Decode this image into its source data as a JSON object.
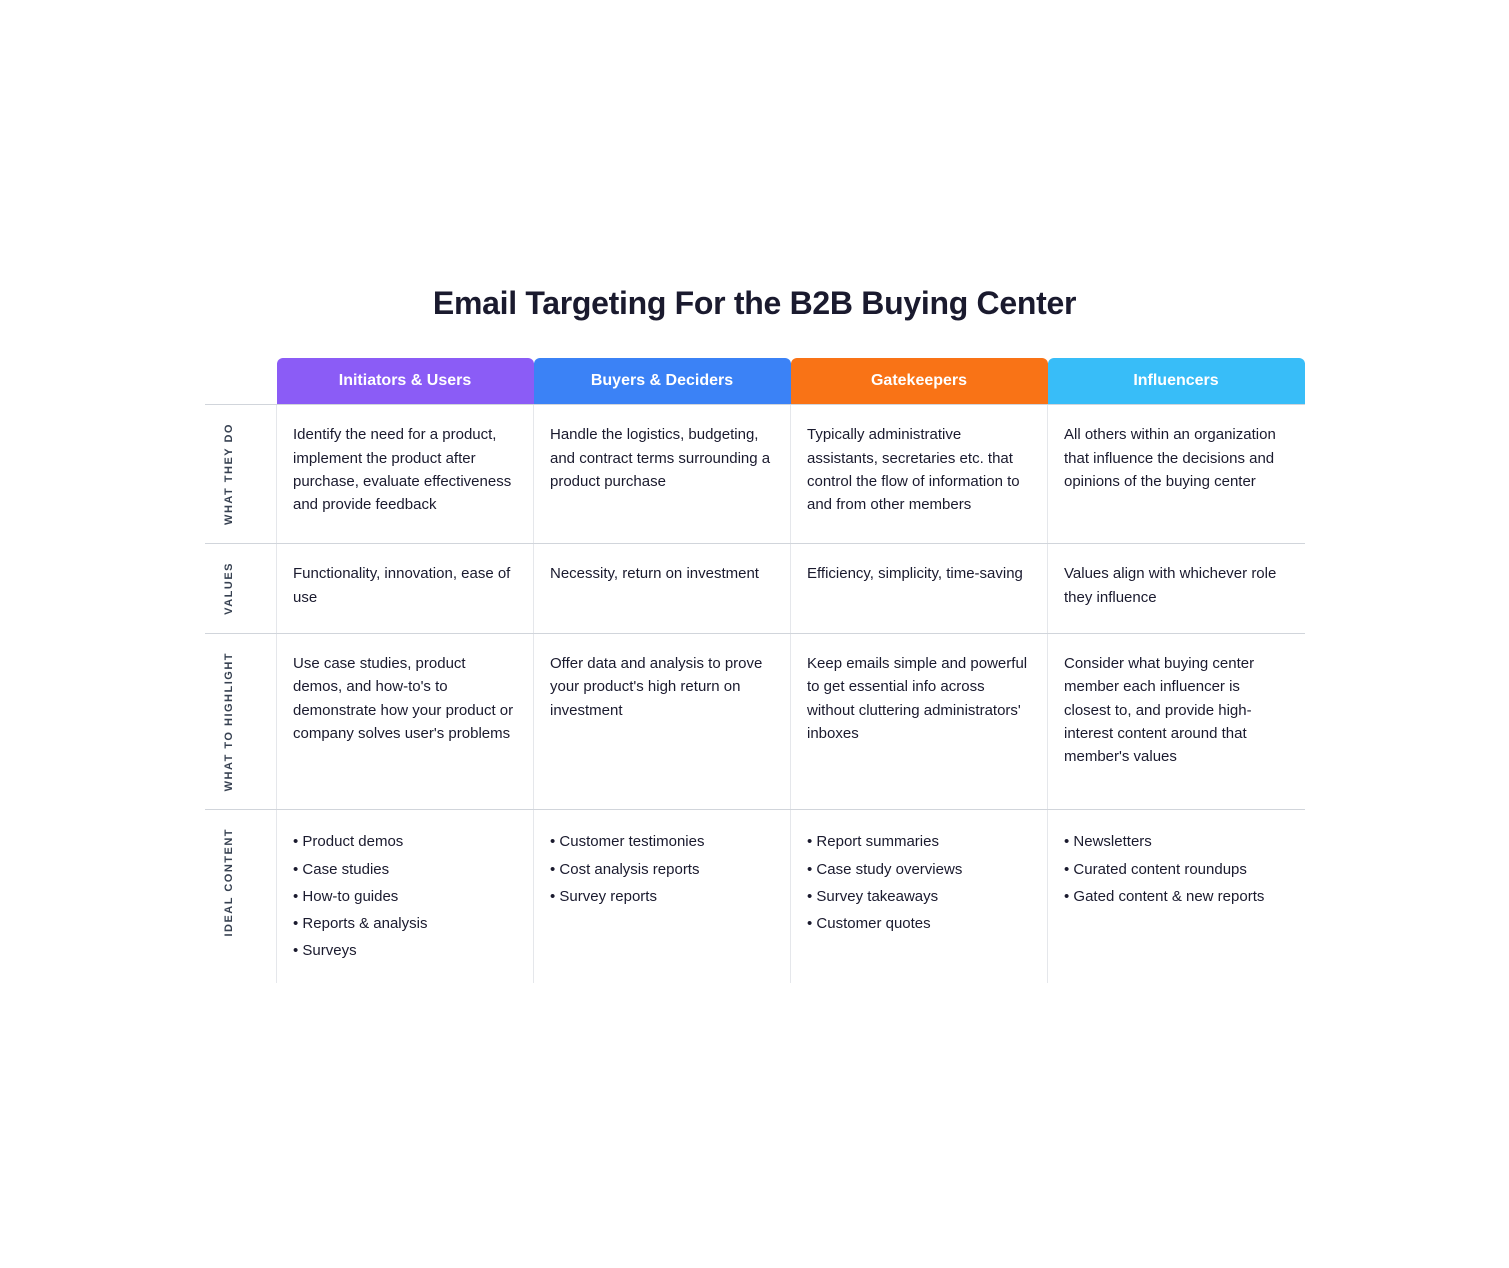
{
  "title": "Email Targeting For the B2B Buying Center",
  "columns": [
    {
      "id": "initiators",
      "label": "Initiators & Users",
      "colorClass": "col-initiators"
    },
    {
      "id": "buyers",
      "label": "Buyers & Deciders",
      "colorClass": "col-buyers"
    },
    {
      "id": "gatekeepers",
      "label": "Gatekeepers",
      "colorClass": "col-gatekeepers"
    },
    {
      "id": "influencers",
      "label": "Influencers",
      "colorClass": "col-influencers"
    }
  ],
  "rows": [
    {
      "id": "what-they-do",
      "label": "WHAT THEY DO",
      "cells": [
        "Identify the need for a product, implement the product after purchase, evaluate effectiveness and provide feedback",
        "Handle the logistics, budgeting, and contract terms surrounding a product purchase",
        "Typically administrative assistants, secretaries etc. that control the flow of information to and from other members",
        "All others within an organization that influence the decisions and opinions of the buying center"
      ]
    },
    {
      "id": "values",
      "label": "VALUES",
      "cells": [
        "Functionality, innovation, ease of use",
        "Necessity, return on investment",
        "Efficiency, simplicity, time-saving",
        "Values align with whichever role they influence"
      ]
    },
    {
      "id": "what-to-highlight",
      "label": "WHAT TO HIGHLIGHT",
      "cells": [
        "Use case studies, product demos, and how-to's to demonstrate how your product or company solves user's problems",
        "Offer data and analysis to prove your product's high return on investment",
        "Keep emails simple and powerful to get essential info across without cluttering administrators' inboxes",
        "Consider what buying center member each influencer is closest to, and provide high-interest content around that member's values"
      ]
    },
    {
      "id": "ideal-content",
      "label": "IDEAL CONTENT",
      "cells_list": [
        [
          "Product demos",
          "Case studies",
          "How-to guides",
          "Reports & analysis",
          "Surveys"
        ],
        [
          "Customer testimonies",
          "Cost analysis reports",
          "Survey reports"
        ],
        [
          "Report summaries",
          "Case study overviews",
          "Survey takeaways",
          "Customer quotes"
        ],
        [
          "Newsletters",
          "Curated content roundups",
          "Gated content & new reports"
        ]
      ]
    }
  ]
}
